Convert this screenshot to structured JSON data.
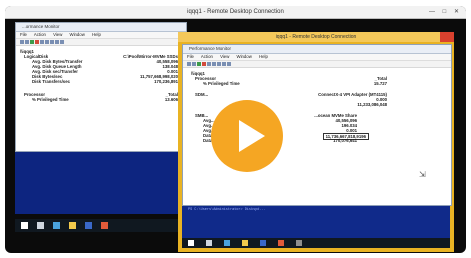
{
  "outer_window": {
    "title": "iqqq1 - Remote Desktop Connection",
    "controls": [
      "—",
      "□",
      "✕"
    ]
  },
  "left_monitor": {
    "window_title": "...ormance Monitor",
    "menu": [
      "File",
      "Action",
      "View",
      "Window",
      "Help"
    ],
    "section_title": "\\\\iqqq1",
    "rows": [
      {
        "label": "LogicalDisk",
        "value": "C:\\Pool\\Mirror-MVMe SSDs",
        "style": "header"
      },
      {
        "label": "Avg. Disk Bytes/Transfer",
        "value": "40,558,096",
        "style": "indent"
      },
      {
        "label": "Avg. Disk Queue Length",
        "value": "138.048",
        "style": "indent"
      },
      {
        "label": "Avg. Disk sec/Transfer",
        "value": "0.001",
        "style": "indent"
      },
      {
        "label": "Disk Bytes/sec",
        "value": "11,757,668,998,020",
        "style": "indent"
      },
      {
        "label": "Disk Transfers/sec",
        "value": "170,236,891",
        "style": "indent"
      },
      {
        "label": "Processor",
        "value": "_Total",
        "style": "header"
      },
      {
        "label": "% Privileged Time",
        "value": "13.606",
        "style": "indent"
      }
    ]
  },
  "right_monitor": {
    "remote_title": "iqqq1 - Remote Desktop Connection",
    "window_title": "Performance Monitor",
    "menu": [
      "File",
      "Action",
      "View",
      "Window",
      "Help"
    ],
    "section_title": "\\\\iqqq1",
    "rows": [
      {
        "label": "Processor",
        "value": "_Total",
        "style": "header"
      },
      {
        "label": "% Privileged Time",
        "value": "15.727",
        "style": "indent"
      },
      {
        "label": "SDM...",
        "value": "ConnectX-4 VPI Adapter (MT4115)",
        "style": "header"
      },
      {
        "label": "",
        "value": "0.000",
        "style": "indent"
      },
      {
        "label": "",
        "value": "11,233,086,048",
        "style": "indent"
      },
      {
        "label": "SMB...",
        "value": "...ocean MVMe Share",
        "style": "header"
      },
      {
        "label": "Avg...",
        "value": "40,556,096",
        "style": "indent2"
      },
      {
        "label": "Avg...",
        "value": "196.034",
        "style": "indent2"
      },
      {
        "label": "Avg...",
        "value": "0.001",
        "style": "indent2"
      },
      {
        "label": "Data Bytes/sec",
        "value": "11,736,667,818,9196",
        "style": "indent2"
      },
      {
        "label": "Data Requests/sec",
        "value": "170,076,641",
        "style": "indent2"
      }
    ]
  },
  "console_text": "PS C:\\Users\\Administrator> Diskspd..."
}
